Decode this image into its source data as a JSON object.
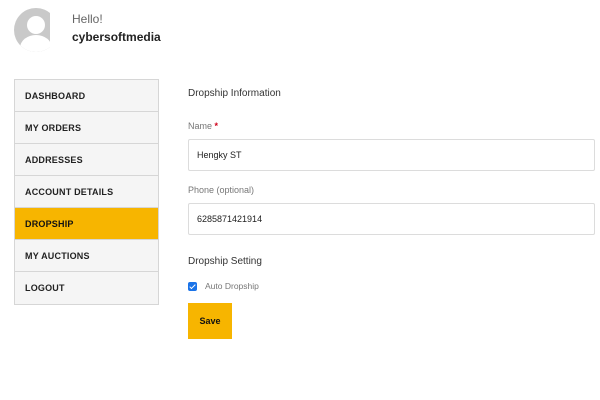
{
  "user": {
    "greeting": "Hello!",
    "username": "cybersoftmedia"
  },
  "nav": {
    "items": [
      {
        "label": "DASHBOARD",
        "active": false
      },
      {
        "label": "MY ORDERS",
        "active": false
      },
      {
        "label": "ADDRESSES",
        "active": false
      },
      {
        "label": "ACCOUNT DETAILS",
        "active": false
      },
      {
        "label": "DROPSHIP",
        "active": true
      },
      {
        "label": "MY AUCTIONS",
        "active": false
      },
      {
        "label": "LOGOUT",
        "active": false
      }
    ]
  },
  "form": {
    "info_title": "Dropship Information",
    "name_label": "Name",
    "name_required_mark": "*",
    "name_value": "Hengky ST",
    "phone_label": "Phone (optional)",
    "phone_value": "6285871421914",
    "setting_title": "Dropship Setting",
    "auto_dropship_label": "Auto Dropship",
    "auto_dropship_checked": true,
    "save_label": "Save"
  },
  "colors": {
    "accent": "#f7b500",
    "checkbox": "#1a73e8",
    "required": "#d0021b"
  }
}
